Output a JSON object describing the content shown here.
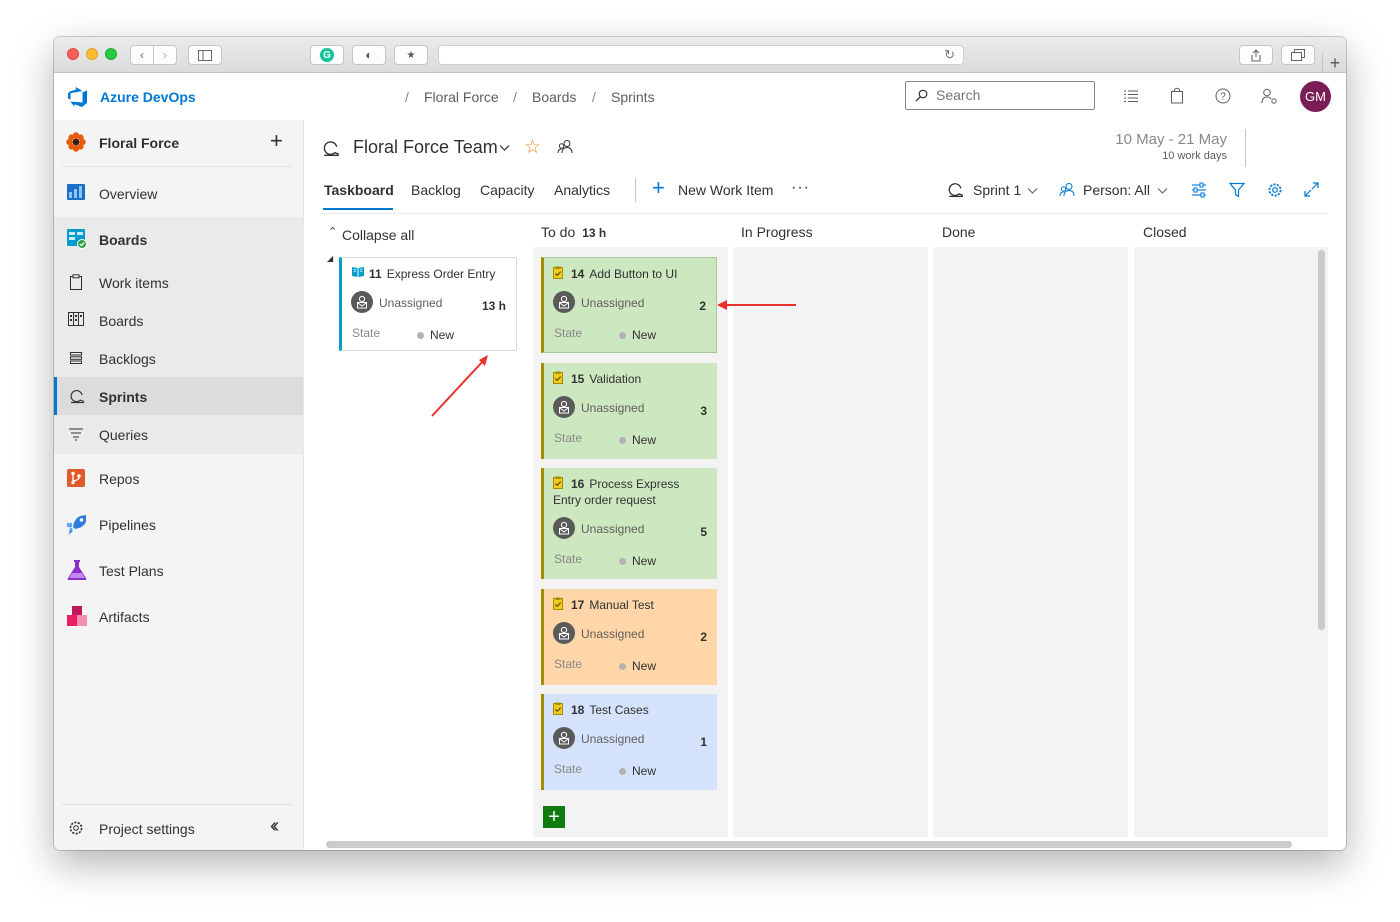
{
  "header": {
    "app_name": "Azure DevOps",
    "breadcrumbs": [
      "Floral Force",
      "Boards",
      "Sprints"
    ],
    "search_placeholder": "Search",
    "avatar_initials": "GM"
  },
  "sidebar": {
    "project": "Floral Force",
    "items": [
      {
        "label": "Overview"
      },
      {
        "label": "Boards"
      },
      {
        "label": "Work items"
      },
      {
        "label": "Boards"
      },
      {
        "label": "Backlogs"
      },
      {
        "label": "Sprints"
      },
      {
        "label": "Queries"
      },
      {
        "label": "Repos"
      },
      {
        "label": "Pipelines"
      },
      {
        "label": "Test Plans"
      },
      {
        "label": "Artifacts"
      }
    ],
    "settings": "Project settings"
  },
  "team": {
    "name": "Floral Force Team",
    "date_range": "10 May - 21 May",
    "work_days": "10 work days"
  },
  "tabs": [
    "Taskboard",
    "Backlog",
    "Capacity",
    "Analytics"
  ],
  "toolbar": {
    "new_item": "New Work Item",
    "more": "···",
    "sprint": "Sprint 1",
    "person": "Person: All"
  },
  "board": {
    "collapse_all": "Collapse all",
    "columns": [
      {
        "name": "To do",
        "hours": "13 h"
      },
      {
        "name": "In Progress"
      },
      {
        "name": "Done"
      },
      {
        "name": "Closed"
      }
    ],
    "parent": {
      "id": "11",
      "title": "Express Order Entry",
      "assignee": "Unassigned",
      "hours": "13 h",
      "state_label": "State",
      "state": "New"
    },
    "tasks": [
      {
        "id": "14",
        "title": "Add Button to UI",
        "assignee": "Unassigned",
        "remaining": "2",
        "state_label": "State",
        "state": "New",
        "color": "#cde8c0"
      },
      {
        "id": "15",
        "title": "Validation",
        "assignee": "Unassigned",
        "remaining": "3",
        "state_label": "State",
        "state": "New",
        "color": "#cde8c0"
      },
      {
        "id": "16",
        "title": "Process Express Entry order request",
        "assignee": "Unassigned",
        "remaining": "5",
        "state_label": "State",
        "state": "New",
        "color": "#cde8c0"
      },
      {
        "id": "17",
        "title": "Manual Test",
        "assignee": "Unassigned",
        "remaining": "2",
        "state_label": "State",
        "state": "New",
        "color": "#ffd6a8"
      },
      {
        "id": "18",
        "title": "Test Cases",
        "assignee": "Unassigned",
        "remaining": "1",
        "state_label": "State",
        "state": "New",
        "color": "#d4e3fb"
      }
    ]
  },
  "colors": {
    "accent": "#0078d4",
    "task_border": "#a38e00",
    "add_button": "#107c10"
  }
}
